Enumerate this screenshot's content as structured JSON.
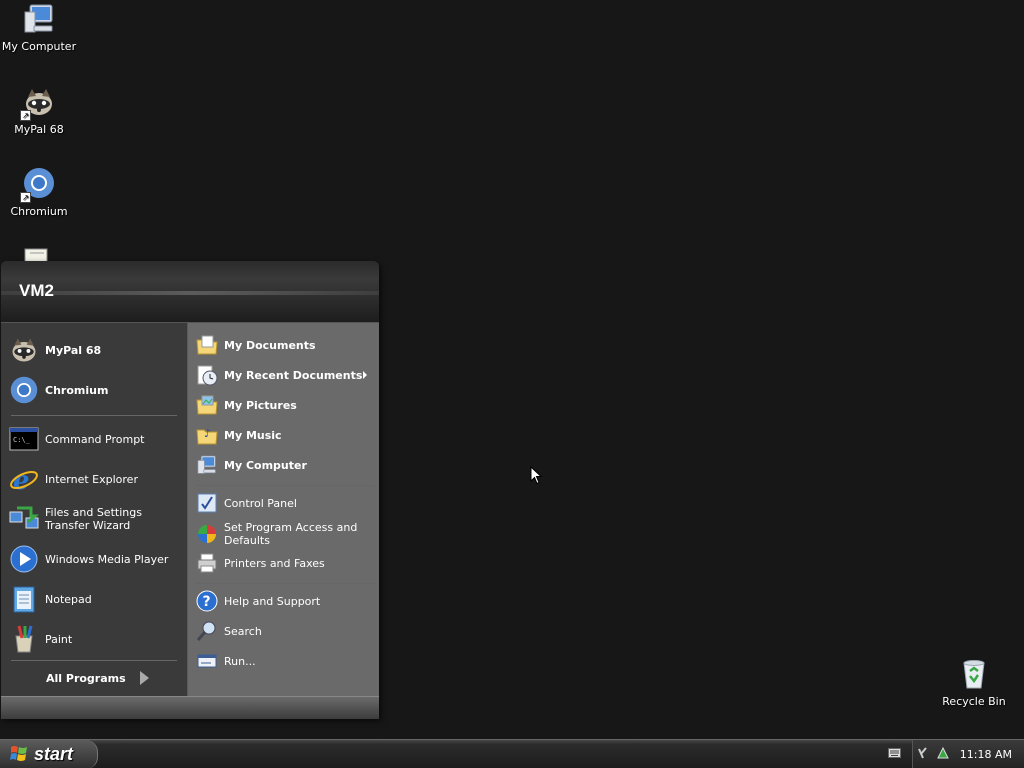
{
  "desktop": {
    "icons": [
      {
        "label": "My Computer",
        "icon": "my-computer-icon"
      },
      {
        "label": "MyPal 68",
        "icon": "mypal-icon"
      },
      {
        "label": "Chromium",
        "icon": "chromium-icon"
      },
      {
        "label": "Recycle Bin",
        "icon": "recycle-bin-icon"
      }
    ]
  },
  "start_menu": {
    "user_name": "VM2",
    "pinned": [
      {
        "label": "MyPal 68",
        "icon": "mypal-icon"
      },
      {
        "label": "Chromium",
        "icon": "chromium-icon"
      }
    ],
    "recent": [
      {
        "label": "Command Prompt",
        "icon": "command-prompt-icon"
      },
      {
        "label": "Internet Explorer",
        "icon": "internet-explorer-icon"
      },
      {
        "label": "Files and Settings Transfer Wizard",
        "icon": "transfer-wizard-icon"
      },
      {
        "label": "Windows Media Player",
        "icon": "media-player-icon"
      },
      {
        "label": "Notepad",
        "icon": "notepad-icon"
      },
      {
        "label": "Paint",
        "icon": "paint-icon"
      }
    ],
    "all_programs": "All Programs",
    "places": [
      {
        "label": "My Documents",
        "icon": "documents-folder-icon"
      },
      {
        "label": "My Recent Documents",
        "icon": "recent-documents-icon"
      },
      {
        "label": "My Pictures",
        "icon": "pictures-folder-icon"
      },
      {
        "label": "My Music",
        "icon": "music-folder-icon"
      },
      {
        "label": "My Computer",
        "icon": "my-computer-icon"
      }
    ],
    "settings": [
      {
        "label": "Control Panel",
        "icon": "control-panel-icon"
      },
      {
        "label": "Set Program Access and Defaults",
        "icon": "program-access-icon"
      },
      {
        "label": "Printers and Faxes",
        "icon": "printer-icon"
      }
    ],
    "tools": [
      {
        "label": "Help and Support",
        "icon": "help-icon"
      },
      {
        "label": "Search",
        "icon": "search-icon"
      },
      {
        "label": "Run...",
        "icon": "run-icon"
      }
    ]
  },
  "taskbar": {
    "start_label": "start",
    "clock": "11:18 AM"
  },
  "colors": {
    "desktop_bg": "#171717",
    "menu_left_bg": "#3a3a3a",
    "menu_right_bg": "#6a6a6a"
  }
}
